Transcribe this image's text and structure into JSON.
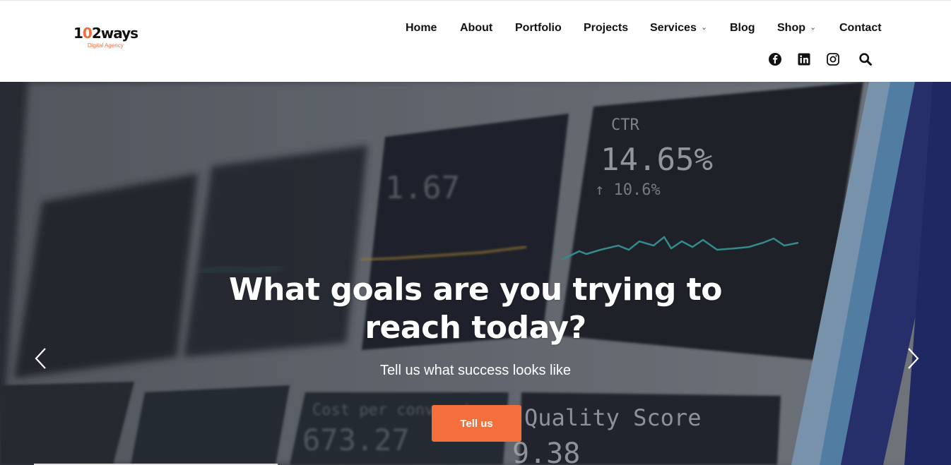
{
  "logo": {
    "wordmark_a": "1",
    "wordmark_accent": "0",
    "wordmark_b": "2ways",
    "tagline": "Digital Agency",
    "brand_color": "#f26b3a"
  },
  "nav": {
    "items": [
      {
        "label": "Home",
        "has_dropdown": false
      },
      {
        "label": "About",
        "has_dropdown": false
      },
      {
        "label": "Portfolio",
        "has_dropdown": false
      },
      {
        "label": "Projects",
        "has_dropdown": false
      },
      {
        "label": "Services",
        "has_dropdown": true
      },
      {
        "label": "Blog",
        "has_dropdown": false
      },
      {
        "label": "Shop",
        "has_dropdown": true
      },
      {
        "label": "Contact",
        "has_dropdown": false
      }
    ]
  },
  "social": [
    "facebook-icon",
    "linkedin-icon",
    "instagram-icon",
    "search-icon"
  ],
  "hero": {
    "title": "What goals are you trying to reach today?",
    "subtitle": "Tell us what success looks like",
    "cta_label": "Tell us",
    "cta_color": "#f56f3d",
    "bg_text": {
      "ctr_label": "CTR",
      "ctr_value": "14.65%",
      "ctr_delta": "↑ 10.6%",
      "quality_label": "Quality Score",
      "quality_value": "9.38",
      "cost_label": "Cost per conversion",
      "cost_value": "673.27",
      "panel_value": "1.67"
    }
  }
}
